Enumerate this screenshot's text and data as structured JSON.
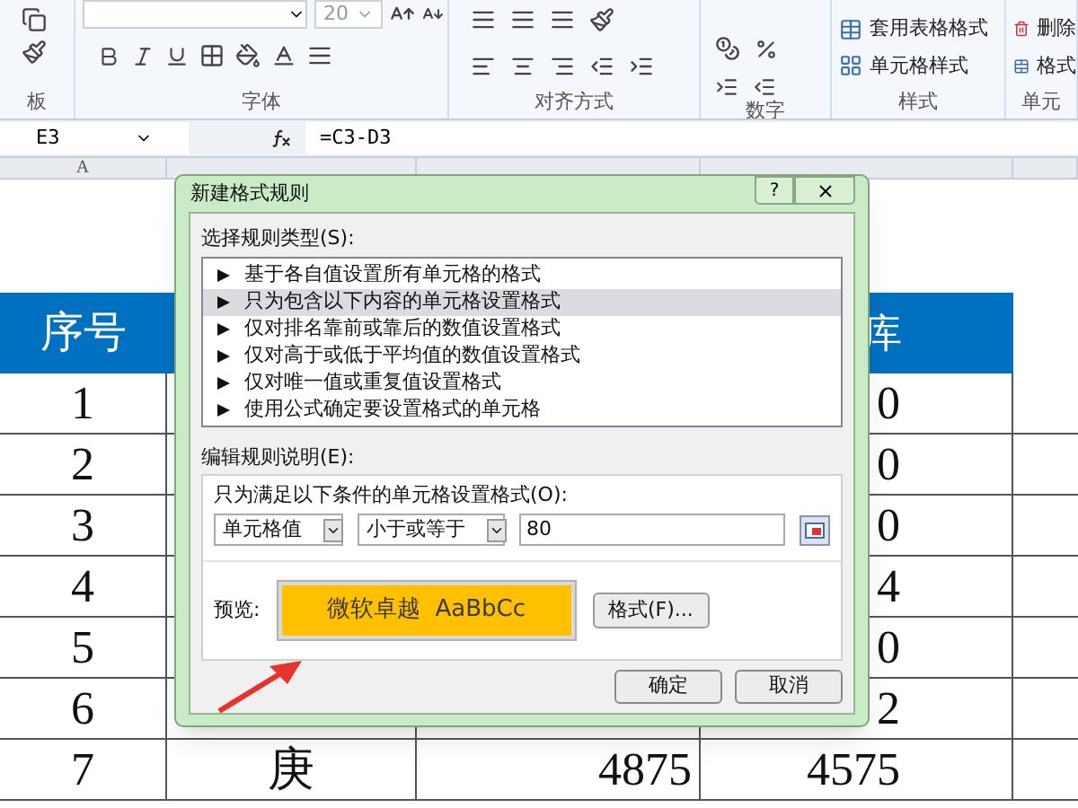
{
  "ribbon": {
    "groups": [
      {
        "label": "板"
      },
      {
        "label": "字体"
      },
      {
        "label": "对齐方式"
      },
      {
        "label": "数字"
      },
      {
        "label": "样式"
      },
      {
        "label": "单元"
      }
    ],
    "font_size": "20",
    "styles_buttons": [
      "套用表格格式",
      "单元格样式"
    ],
    "cells_buttons": [
      "删除",
      "格式"
    ]
  },
  "formula_bar": {
    "name_box": "E3",
    "formula": "=C3-D3"
  },
  "column_headers": [
    "A"
  ],
  "sheet": {
    "header": [
      "序号",
      "库"
    ],
    "rows": [
      {
        "a": "1",
        "b": "",
        "c": "",
        "d": "0"
      },
      {
        "a": "2",
        "b": "",
        "c": "",
        "d": "0"
      },
      {
        "a": "3",
        "b": "",
        "c": "",
        "d": "0"
      },
      {
        "a": "4",
        "b": "",
        "c": "",
        "d": "4"
      },
      {
        "a": "5",
        "b": "",
        "c": "",
        "d": "0"
      },
      {
        "a": "6",
        "b": "",
        "c": "",
        "d": "2"
      },
      {
        "a": "7",
        "b": "庚",
        "c": "4875",
        "d": "4575"
      }
    ]
  },
  "dialog": {
    "title": "新建格式规则",
    "help_button": "?",
    "rule_type_label": "选择规则类型(S):",
    "rule_types": [
      {
        "label": "基于各自值设置所有单元格的格式",
        "selected": false
      },
      {
        "label": "只为包含以下内容的单元格设置格式",
        "selected": true
      },
      {
        "label": "仅对排名靠前或靠后的数值设置格式",
        "selected": false
      },
      {
        "label": "仅对高于或低于平均值的数值设置格式",
        "selected": false
      },
      {
        "label": "仅对唯一值或重复值设置格式",
        "selected": false
      },
      {
        "label": "使用公式确定要设置格式的单元格",
        "selected": false
      }
    ],
    "description_label": "编辑规则说明(E):",
    "condition_label": "只为满足以下条件的单元格设置格式(O):",
    "selects": [
      "单元格值",
      "小于或等于"
    ],
    "value": "80",
    "preview_label": "预览:",
    "preview_text": "微软卓越  AaBbCc",
    "format_button": "格式(F)...",
    "buttons": [
      "确定",
      "取消"
    ]
  }
}
